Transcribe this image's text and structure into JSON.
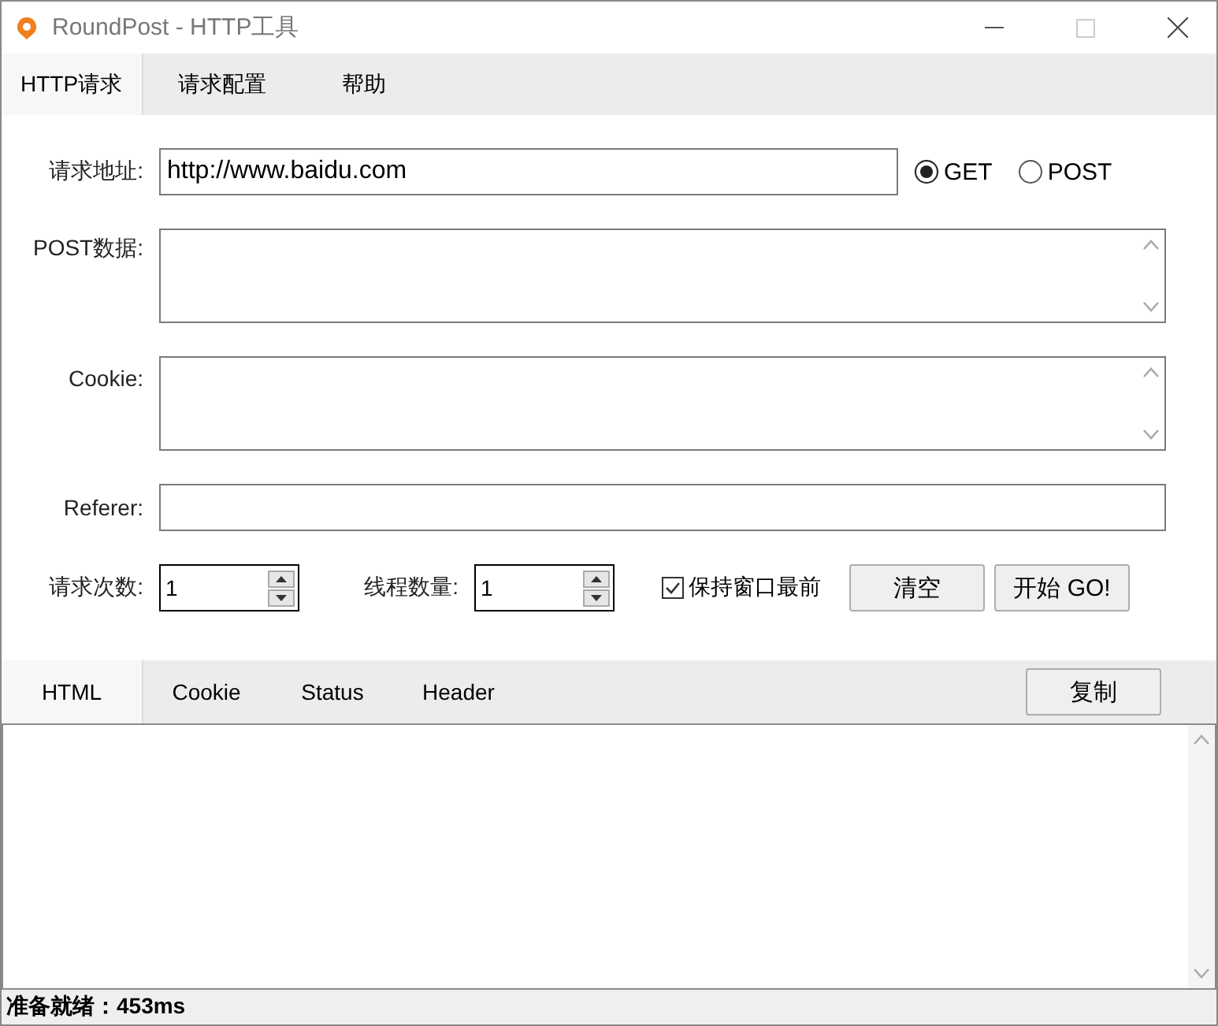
{
  "window": {
    "title": "RoundPost - HTTP工具"
  },
  "menu_tabs": [
    {
      "label": "HTTP请求",
      "selected": true
    },
    {
      "label": "请求配置",
      "selected": false
    },
    {
      "label": "帮助",
      "selected": false
    }
  ],
  "request": {
    "url_label": "请求地址:",
    "url": "http://www.baidu.com",
    "methods": [
      {
        "label": "GET",
        "selected": true
      },
      {
        "label": "POST",
        "selected": false
      }
    ],
    "post_label": "POST数据:",
    "cookie_label": "Cookie:",
    "referer_label": "Referer:",
    "count_label": "请求次数:",
    "count": "1",
    "threads_label": "线程数量:",
    "threads": "1",
    "keep_on_top": {
      "label": "保持窗口最前",
      "checked": true
    },
    "buttons": [
      "清空",
      "开始 GO!"
    ]
  },
  "result_tabs": [
    {
      "label": "HTML",
      "selected": true
    },
    {
      "label": "Cookie",
      "selected": false
    },
    {
      "label": "Status",
      "selected": false
    },
    {
      "label": "Header",
      "selected": false
    }
  ],
  "copy_button": "复制",
  "status_bar": "准备就绪：453ms"
}
